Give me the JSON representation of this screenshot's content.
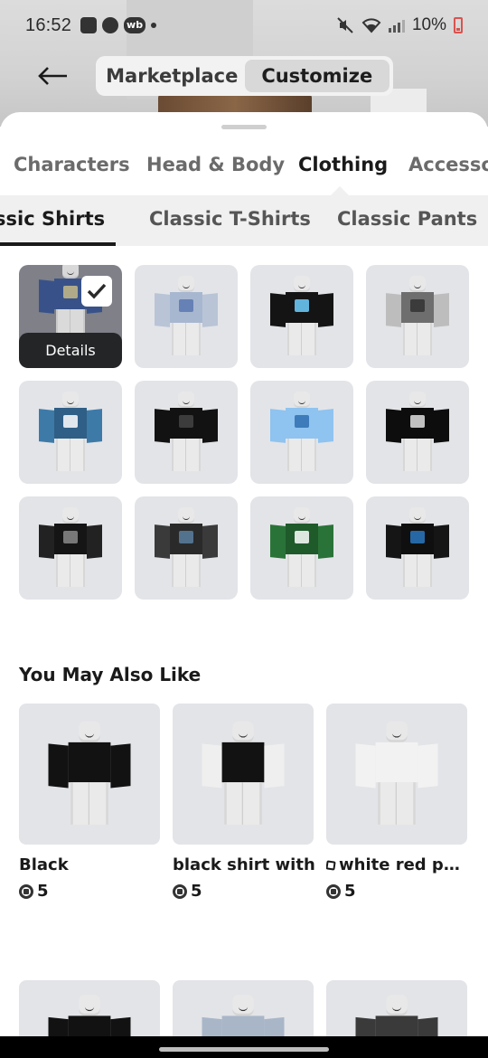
{
  "status_bar": {
    "time": "16:52",
    "battery": "10%",
    "notification_badge": "wb"
  },
  "header": {
    "back_icon": "arrow-left-icon",
    "segments": [
      {
        "label": "Marketplace",
        "active": false
      },
      {
        "label": "Customize",
        "active": true
      }
    ]
  },
  "category_tabs": [
    {
      "label": "Characters",
      "active": false
    },
    {
      "label": "Head & Body",
      "active": false
    },
    {
      "label": "Clothing",
      "active": true
    },
    {
      "label": "Accesso",
      "active": false
    }
  ],
  "sub_tabs": [
    {
      "label": "ssic Shirts",
      "active": true
    },
    {
      "label": "Classic T-Shirts",
      "active": false
    },
    {
      "label": "Classic Pants",
      "active": false
    }
  ],
  "owned_items": {
    "details_label": "Details",
    "items": [
      {
        "shirt": "#2c4a8a",
        "sleeve": "#2c4a8a",
        "accent": "#d2c48a",
        "selected": true
      },
      {
        "shirt": "#a8b7d0",
        "sleeve": "#b9c4d6",
        "accent": "#5a78b0",
        "selected": false
      },
      {
        "shirt": "#141414",
        "sleeve": "#141414",
        "accent": "#6fd0ff",
        "selected": false
      },
      {
        "shirt": "#6e6e6e",
        "sleeve": "#bdbdbd",
        "accent": "#333333",
        "selected": false
      },
      {
        "shirt": "#2f5f86",
        "sleeve": "#3d7aa8",
        "accent": "#ffffff",
        "selected": false
      },
      {
        "shirt": "#121212",
        "sleeve": "#121212",
        "accent": "#444444",
        "selected": false
      },
      {
        "shirt": "#8fc3f0",
        "sleeve": "#8fc3f0",
        "accent": "#2f6fb0",
        "selected": false
      },
      {
        "shirt": "#0d0d0d",
        "sleeve": "#0d0d0d",
        "accent": "#e0e0e0",
        "selected": false
      },
      {
        "shirt": "#151515",
        "sleeve": "#222222",
        "accent": "#8a8a8a",
        "selected": false
      },
      {
        "shirt": "#2a2a2a",
        "sleeve": "#3a3a3a",
        "accent": "#5b7fa0",
        "selected": false
      },
      {
        "shirt": "#1f5a2b",
        "sleeve": "#2a7338",
        "accent": "#ffffff",
        "selected": false
      },
      {
        "shirt": "#0f0f0f",
        "sleeve": "#151515",
        "accent": "#2a78c0",
        "selected": false
      }
    ]
  },
  "recommendations": {
    "title": "You May Also Like",
    "items": [
      {
        "name": "Black",
        "price": "5",
        "limited": false,
        "shirt": "#121212",
        "sleeve": "#121212"
      },
      {
        "name": "black shirt with",
        "price": "5",
        "limited": false,
        "shirt": "#121212",
        "sleeve": "#efefef"
      },
      {
        "name": "white red pol...",
        "price": "5",
        "limited": true,
        "shirt": "#f2f2f2",
        "sleeve": "#f2f2f2"
      }
    ],
    "next_row": [
      {
        "shirt": "#121212"
      },
      {
        "shirt": "#a9b6c8"
      },
      {
        "shirt": "#3a3a3a"
      }
    ]
  }
}
